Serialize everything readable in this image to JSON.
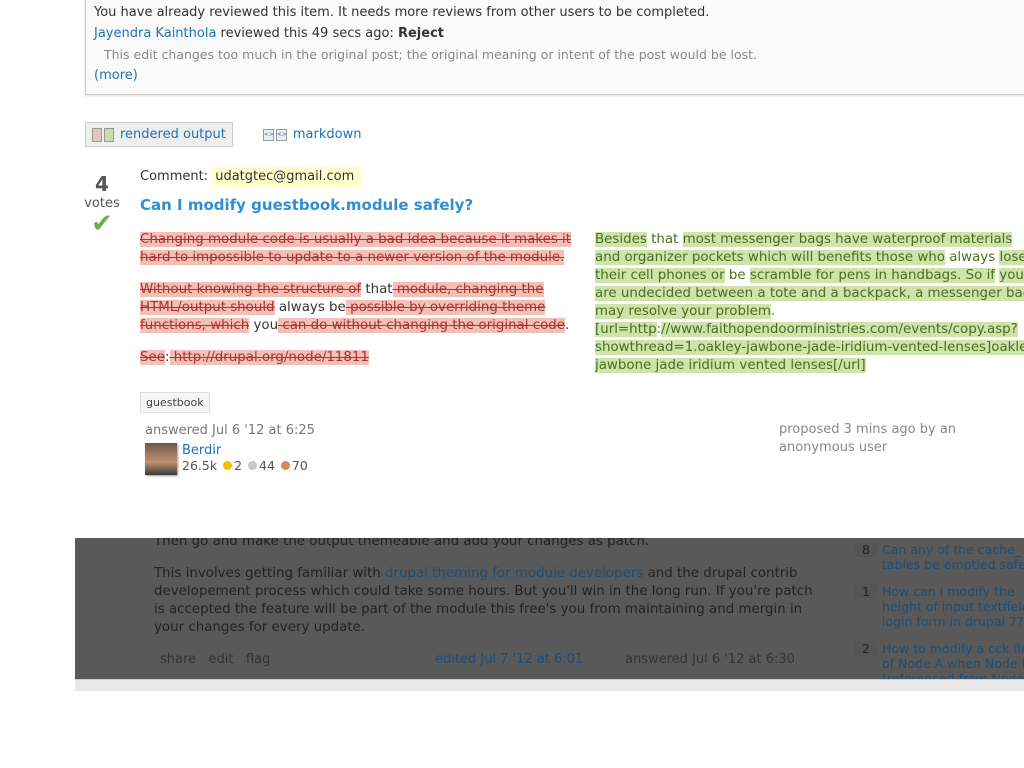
{
  "notice": {
    "line1": "You have already reviewed this item. It needs more reviews from other users to be completed.",
    "reviewer": "Jayendra Kainthola",
    "reviewed_text": " reviewed this 49 secs ago: ",
    "verdict": "Reject",
    "reason": "This edit changes too much in the original post; the original meaning or intent of the post would be lost.",
    "more": "(more)"
  },
  "tabs": [
    {
      "label": "rendered output",
      "active": true
    },
    {
      "label": "markdown",
      "active": false
    }
  ],
  "post": {
    "votes": "4",
    "votes_label": "votes",
    "comment_label": "Comment: ",
    "comment_value": "udatgtec@gmail.com",
    "title": "Can I modify guestbook.module safely?"
  },
  "diff_left": [
    [
      {
        "t": "del",
        "s": "Changing module code is usually a bad idea because it makes it hard to impossible to update to a newer version of the module."
      }
    ],
    [
      {
        "t": "del",
        "s": "Without knowing the structure of"
      },
      {
        "t": "",
        "s": " that"
      },
      {
        "t": "del",
        "s": " module, changing the HTML/output should"
      },
      {
        "t": "",
        "s": " always be"
      },
      {
        "t": "del",
        "s": " possible by overriding theme functions, which"
      },
      {
        "t": "",
        "s": " you"
      },
      {
        "t": "del",
        "s": " can do without changing the original code"
      },
      {
        "t": "",
        "s": "."
      }
    ],
    [
      {
        "t": "del",
        "s": "See"
      },
      {
        "t": "",
        "s": ":"
      },
      {
        "t": "del",
        "s": " http://drupal.org/node/11811"
      }
    ]
  ],
  "diff_right": [
    {
      "t": "ins",
      "s": "Besides"
    },
    {
      "t": "",
      "s": " that "
    },
    {
      "t": "ins",
      "s": "most messenger bags have waterproof materials and organizer pockets which will benefits those who"
    },
    {
      "t": "",
      "s": " always "
    },
    {
      "t": "ins",
      "s": "lose their cell phones or"
    },
    {
      "t": "",
      "s": " be "
    },
    {
      "t": "ins",
      "s": "scramble for pens in handbags. So if"
    },
    {
      "t": "",
      "s": " "
    },
    {
      "t": "ins",
      "s": "you are undecided between a tote and a backpack, a messenger bag may resolve your problem"
    },
    {
      "t": "",
      "s": ". "
    },
    {
      "t": "ins",
      "s": "[url=http"
    },
    {
      "t": "",
      "s": ":"
    },
    {
      "t": "ins",
      "s": "//www.faithopendoorministries.com/events/copy.asp?showthread=1.oakley-jawbone-jade-iridium-vented-lenses]oakley jawbone jade iridium vented lenses[/url]"
    }
  ],
  "tag": "guestbook",
  "answer": {
    "time": "answered Jul 6 '12 at 6:25",
    "user": "Berdir",
    "rep": "26.5k",
    "gold": "2",
    "silver": "44",
    "bronze": "70"
  },
  "proposed": "proposed 3 mins ago by an anonymous user",
  "background": {
    "line0": "Then go and make the output themeable and add your changes as patch.",
    "p_pre": "This involves getting familiar with ",
    "p_link": "drupal theming for module developers",
    "p_post": " and the drupal contrib developement process which could take some hours. But you'll win in the long run. If you're patch is accepted the feature will be part of the module this free's you from maintaining and mergin in your changes for every update.",
    "share": "share",
    "edit": "edit",
    "flag": "flag",
    "edited": "edited Jul 7 '12 at 6:01",
    "answered": "answered Jul 6 '12 at 6:30",
    "related": [
      {
        "n": "8",
        "q": "Can any of the cache_ tables be emptied safely?"
      },
      {
        "n": "1",
        "q": "How can I modify the height of input textfield in login form in drupal 7?"
      },
      {
        "n": "2",
        "q": "How to modify a cck field of Node A when Node B (referenced from Node A)"
      }
    ]
  },
  "colors": {
    "del_bg": "#f3c0b7",
    "ins_bg": "#cfe3ac",
    "link": "#1a73b8",
    "accept": "#6ab04c"
  }
}
